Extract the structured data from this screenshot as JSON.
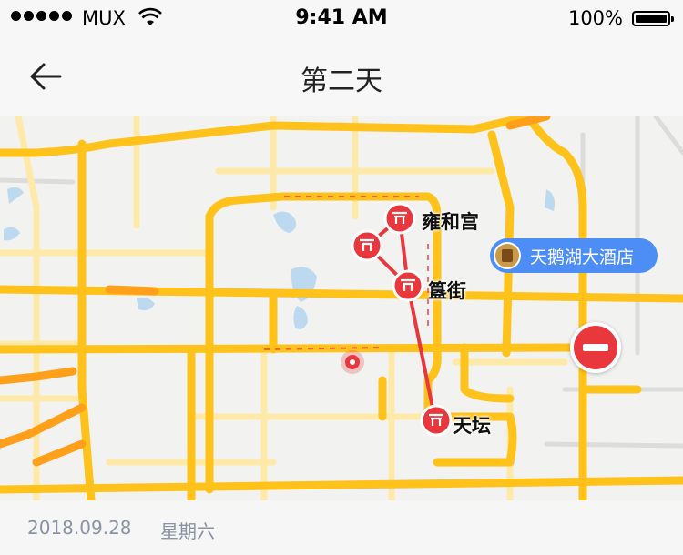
{
  "status_bar": {
    "carrier": "MUX",
    "time": "9:41 AM",
    "battery": "100%"
  },
  "nav": {
    "title": "第二天",
    "back_icon": "arrow-left-icon"
  },
  "map": {
    "route_color": "#e8383d",
    "road_color": "#ffc21a",
    "pois": [
      {
        "label": "雍和宫",
        "icon": "temple-gate-icon"
      },
      {
        "label": "",
        "icon": "temple-gate-icon"
      },
      {
        "label": "簋街",
        "icon": "temple-gate-icon"
      },
      {
        "label": "天坛",
        "icon": "temple-gate-icon"
      }
    ],
    "hotel": {
      "label": "天鹅湖大酒店",
      "icon": "hotel-icon",
      "color": "#4d8df6"
    },
    "remove_icon": "no-entry-icon",
    "location_icon": "location-dot-icon"
  },
  "footer": {
    "date": "2018.09.28",
    "weekday": "星期六"
  }
}
